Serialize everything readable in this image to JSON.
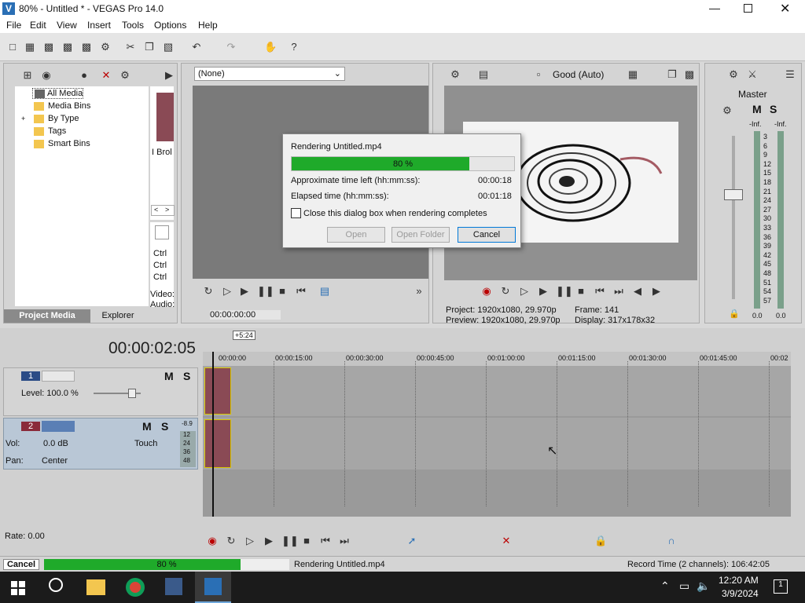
{
  "window": {
    "title": "80% - Untitled * - VEGAS Pro 14.0"
  },
  "menu": [
    "File",
    "Edit",
    "View",
    "Insert",
    "Tools",
    "Options",
    "Help"
  ],
  "media": {
    "items": [
      "All Media",
      "Media Bins",
      "By Type",
      "Tags",
      "Smart Bins"
    ],
    "tabs": [
      "Project Media",
      "Explorer"
    ],
    "thumb_label": "I Brol",
    "scroll_left": "<",
    "scroll_right": ">",
    "ctrl_lines": [
      "Ctrl",
      "Ctrl",
      "Ctrl"
    ],
    "video_label": "Video:",
    "audio_label": "Audio:"
  },
  "trimmer": {
    "dropdown": "(None)",
    "timecode": "00:00:00:00"
  },
  "preview": {
    "quality": "Good (Auto)",
    "project": "Project:  1920x1080, 29.970p",
    "preview_line": "Preview:  1920x1080, 29.970p",
    "frame": "Frame:      141",
    "display": "Display:    317x178x32"
  },
  "master": {
    "label": "Master",
    "m": "M",
    "s": "S",
    "inf_l": "-Inf.",
    "inf_r": "-Inf.",
    "scale": [
      "3",
      "6",
      "9",
      "12",
      "15",
      "18",
      "21",
      "24",
      "27",
      "30",
      "33",
      "36",
      "39",
      "42",
      "45",
      "48",
      "51",
      "54",
      "57"
    ],
    "val_l": "0.0",
    "val_r": "0.0"
  },
  "dialog": {
    "title": "Rendering Untitled.mp4",
    "progress": 0.8,
    "progress_label": "80 %",
    "time_left_label": "Approximate time left (hh:mm:ss):",
    "time_left": "00:00:18",
    "elapsed_label": "Elapsed time (hh:mm:ss):",
    "elapsed": "00:01:18",
    "checkbox_label": "Close this dialog box when rendering completes",
    "open": "Open",
    "open_folder": "Open Folder",
    "cancel": "Cancel"
  },
  "timeline": {
    "timecode": "00:00:02:05",
    "marker": "+5:24",
    "ruler": [
      "00:00:00",
      "00:00:15:00",
      "00:00:30:00",
      "00:00:45:00",
      "00:01:00:00",
      "00:01:15:00",
      "00:01:30:00",
      "00:01:45:00",
      "00:02"
    ],
    "track1": {
      "num": "1",
      "level": "Level: 100.0 %",
      "m": "M",
      "s": "S"
    },
    "track2": {
      "num": "2",
      "vol_label": "Vol:",
      "vol": "0.0 dB",
      "pan_label": "Pan:",
      "pan": "Center",
      "touch": "Touch",
      "m": "M",
      "s": "S",
      "meter_top": "-8.9",
      "meter": [
        "12",
        "24",
        "36",
        "48"
      ]
    },
    "rate": "Rate: 0.00"
  },
  "status": {
    "cancel": "Cancel",
    "progress": 0.8,
    "progress_label": "80 %",
    "rendering": "Rendering Untitled.mp4",
    "record_time": "Record Time (2 channels): 106:42:05"
  },
  "taskbar": {
    "time": "12:20 AM",
    "date": "3/9/2024",
    "notif": "1"
  },
  "colors": {
    "progress": "#1faa2a",
    "track_bg": "#b9c7d6",
    "clip": "#8a4a55"
  }
}
